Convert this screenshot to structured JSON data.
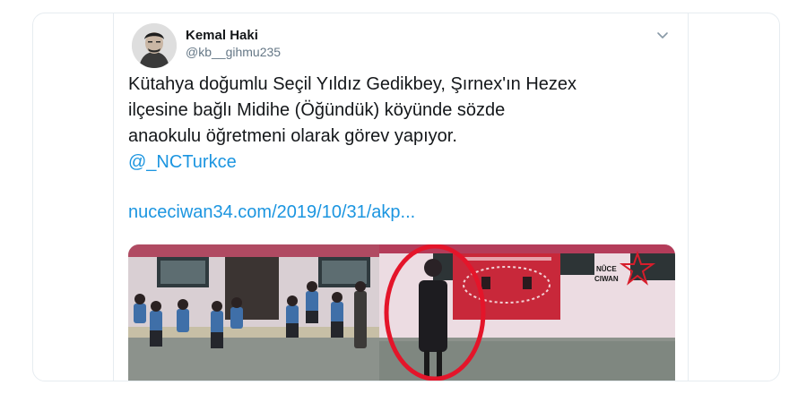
{
  "tweet": {
    "author_name": "Kemal Haki",
    "author_handle": "@kb__gihmu235",
    "text_lines": [
      "Kütahya doğumlu Seçil Yıldız Gedikbey, Şırnex'ın Hezex",
      "ilçesine bağlı Midihe (Öğündük) köyünde sözde",
      "anaokulu öğretmeni olarak görev yapıyor."
    ],
    "mention": "@_NCTurkce",
    "link": "nuceciwan34.com/2019/10/31/akp...",
    "media": {
      "watermark": [
        "NÛCE",
        "CIWAN"
      ],
      "colors": {
        "flag_red": "#c8283a",
        "highlight_circle": "#e4152a",
        "wall": "#ecdce2",
        "wall_trim": "#b43c5a"
      }
    },
    "icons": {
      "avatar": "avatar-photo",
      "menu": "chevron-down-icon"
    }
  }
}
